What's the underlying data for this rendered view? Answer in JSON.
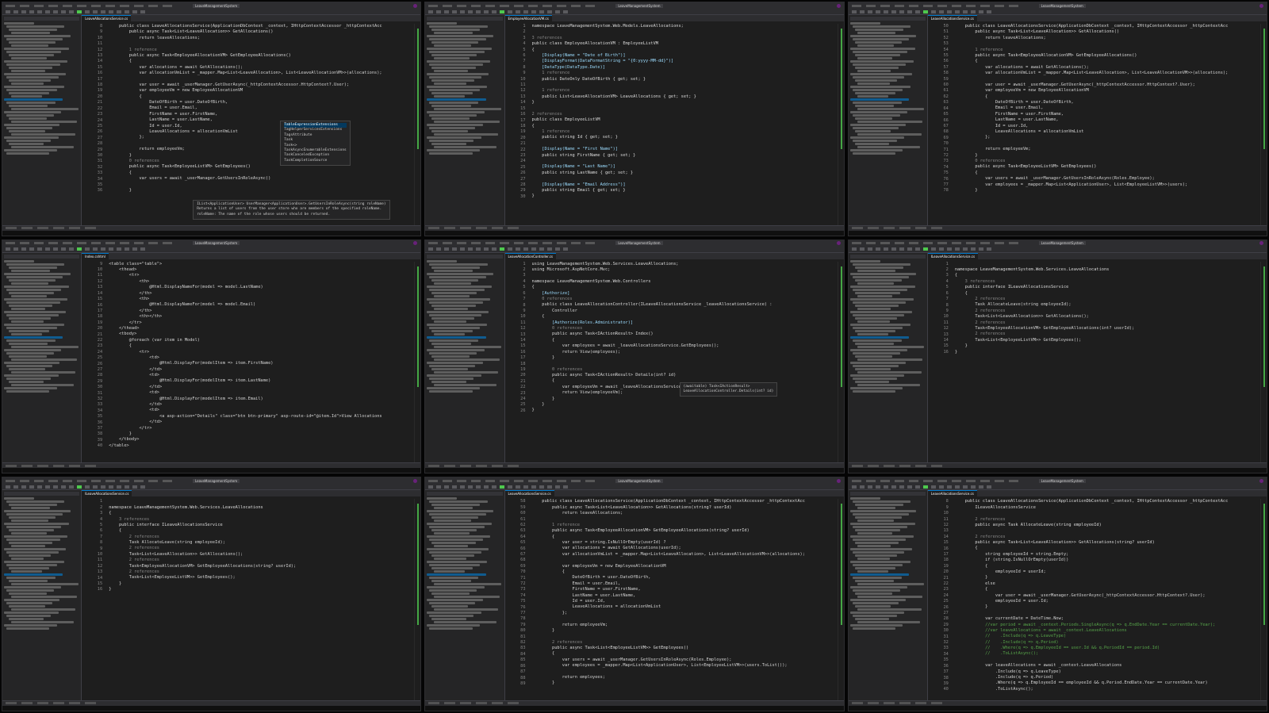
{
  "window": {
    "solution": "LeaveManagementSystem"
  },
  "panels": [
    {
      "tab": "LeaveAllocationsService.cs",
      "start": 8,
      "lines": [
        "    public class LeaveAllocationsService(ApplicationDbContext _context, IHttpContextAccessor _httpContextAcc",
        "        public async Task<List<LeaveAllocation>> GetAllocations()",
        "            return leaveAllocations;",
        "",
        "        1 reference",
        "        public async Task<EmployeeAllocationVM> GetEmployeeAllocations()",
        "        {",
        "            var allocations = await GetAllocations();",
        "            var allocationVmList = _mapper.Map<List<LeaveAllocation>, List<LeaveAllocationVM>>(allocations);",
        "",
        "            var user = await _userManager.GetUserAsync(_httpContextAccessor.HttpContext?.User);",
        "            var employeeVm = new EmployeeAllocationVM",
        "            {",
        "                DateOfBirth = user.DateOfBirth,",
        "                Email = user.Email,",
        "                FirstName = user.FirstName,",
        "                LastName = user.LastName,",
        "                Id = user.Id,",
        "                LeaveAllocations = allocationVmList",
        "            };",
        "",
        "            return employeeVm;",
        "        }",
        "        0 references",
        "        public async Task<EmployeeListVM> GetEmployees()",
        "        {",
        "            var users = await _userManager.GetUsersInRoleAsync()",
        "",
        "        }"
      ],
      "popup": {
        "items": [
          "TableExpressionExtensions",
          "TagHelperServicesExtensions",
          "TagsAttribute",
          "Task",
          "Task<>",
          "TaskAsyncEnumerableExtensions",
          "TaskCanceledException",
          "TaskCompletionSource"
        ],
        "tooltip": "IList<ApplicationUser> UserManager<ApplicationUser>.GetUsersInRoleAsync(string roleName)\nReturns a list of users from the user store who are members of the specified roleName.\nroleName: The name of the role whose users should be returned."
      }
    },
    {
      "tab": "EmployeeAllocationVM.cs",
      "start": 1,
      "lines": [
        "namespace LeaveManagementSystem.Web.Models.LeaveAllocations;",
        "",
        "3 references",
        "public class EmployeeAllocationVM : EmployeeListVM",
        "{",
        "    [Display(Name = \"Date of Birth\")]",
        "    [DisplayFormat(DataFormatString = \"{0:yyyy-MM-dd}\")]",
        "    [DataType(DataType.Date)]",
        "    1 reference",
        "    public DateOnly DateOfBirth { get; set; }",
        "",
        "    1 reference",
        "    public List<LeaveAllocationVM> LeaveAllocations { get; set; }",
        "}",
        "",
        "2 references",
        "public class EmployeeListVM",
        "{",
        "    1 reference",
        "    public string Id { get; set; }",
        "",
        "    [Display(Name = \"First Name\")]",
        "    public string FirstName { get; set; }",
        "",
        "    [Display(Name = \"Last Name\")]",
        "    public string LastName { get; set; }",
        "",
        "    [Display(Name = \"Email Address\")]",
        "    public string Email { get; set; }",
        "}"
      ]
    },
    {
      "tab": "LeaveAllocationsService.cs",
      "start": 50,
      "lines": [
        "    public class LeaveAllocationsService(ApplicationDbContext _context, IHttpContextAccessor _httpContextAcc",
        "        public async Task<List<LeaveAllocation>> GetAllocations()",
        "            return leaveAllocations;",
        "",
        "        1 reference",
        "        public async Task<EmployeeAllocationVM> GetEmployeeAllocations()",
        "        {",
        "            var allocations = await GetAllocations();",
        "            var allocationVmList = _mapper.Map<List<LeaveAllocation>, List<LeaveAllocationVM>>(allocations);",
        "",
        "            var user = await _userManager.GetUserAsync(_httpContextAccessor.HttpContext?.User);",
        "            var employeeVm = new EmployeeAllocationVM",
        "            {",
        "                DateOfBirth = user.DateOfBirth,",
        "                Email = user.Email,",
        "                FirstName = user.FirstName,",
        "                LastName = user.LastName,",
        "                Id = user.Id,",
        "                LeaveAllocations = allocationVmList",
        "            };",
        "",
        "            return employeeVm;",
        "        }",
        "        0 references",
        "        public async Task<EmployeeListVM> GetEmployees()",
        "        {",
        "            var users = await _userManager.GetUsersInRoleAsync(Roles.Employee);",
        "            var employees = _mapper.Map<List<ApplicationUser>, List<EmployeeListVM>>(users);",
        "        }"
      ]
    },
    {
      "tab": "Index.cshtml",
      "start": 9,
      "lines": [
        "<table class=\"table\">",
        "    <thead>",
        "        <tr>",
        "            <th>",
        "                @Html.DisplayNameFor(model => model.LastName)",
        "            </th>",
        "            <th>",
        "                @Html.DisplayNameFor(model => model.Email)",
        "            </th>",
        "            <th></th>",
        "        </tr>",
        "    </thead>",
        "    <tbody>",
        "        @foreach (var item in Model)",
        "        {",
        "            <tr>",
        "                <td>",
        "                    @Html.DisplayFor(modelItem => item.FirstName)",
        "                </td>",
        "                <td>",
        "                    @Html.DisplayFor(modelItem => item.LastName)",
        "                </td>",
        "                <td>",
        "                    @Html.DisplayFor(modelItem => item.Email)",
        "                </td>",
        "                <td>",
        "                    <a asp-action=\"Details\" class=\"btn btn-primary\" asp-route-id=\"@item.Id\">View Allocations",
        "                </td>",
        "            </tr>",
        "        }",
        "    </tbody>",
        "</table>"
      ]
    },
    {
      "tab": "LeaveAllocationController.cs",
      "start": 1,
      "lines": [
        "using LeaveManagementSystem.Web.Services.LeaveAllocations;",
        "using Microsoft.AspNetCore.Mvc;",
        "",
        "namespace LeaveManagementSystem.Web.Controllers",
        "{",
        "    [Authorize]",
        "    0 references",
        "    public class LeaveAllocationController(ILeaveAllocationsService _leaveAllocationsService) :",
        "        Controller",
        "    {",
        "        [Authorize(Roles.Administrator)]",
        "        0 references",
        "        public async Task<IActionResult> Index()",
        "        {",
        "            var employees = await _leaveAllocationsService.GetEmployees();",
        "            return View(employees);",
        "        }",
        "",
        "        0 references",
        "        public async Task<IActionResult> Details(int? id)",
        "        {",
        "            var employeeVm = await _leaveAllocationsService.GetEmployeeAllocations();",
        "            return View(employeeVm);",
        "        }",
        "    }",
        "}"
      ],
      "tooltip": "(awaitable) Task<IActionResult>\nLeaveAllocationController.Details(int? id)"
    },
    {
      "tab": "ILeaveAllocationsService.cs",
      "start": 1,
      "lines": [
        "",
        "namespace LeaveManagementSystem.Web.Services.LeaveAllocations",
        "{",
        "    3 references",
        "    public interface ILeaveAllocationsService",
        "    {",
        "        2 references",
        "        Task AllocateLeave(string employeeId);",
        "        2 references",
        "        Task<List<LeaveAllocation>> GetAllocations();",
        "        2 references",
        "        Task<EmployeeAllocationVM> GetEmployeeAllocations(int? userId);",
        "        2 references",
        "        Task<List<EmployeeListVM>> GetEmployees();",
        "    }",
        "}"
      ]
    },
    {
      "tab": "ILeaveAllocationsService.cs",
      "start": 1,
      "lines": [
        "",
        "namespace LeaveManagementSystem.Web.Services.LeaveAllocations",
        "{",
        "    3 references",
        "    public interface ILeaveAllocationsService",
        "    {",
        "        2 references",
        "        Task AllocateLeave(string employeeId);",
        "        2 references",
        "        Task<List<LeaveAllocation>> GetAllocations();",
        "        2 references",
        "        Task<EmployeeAllocationVM> GetEmployeeAllocations(string? userId);",
        "        2 references",
        "        Task<List<EmployeeListVM>> GetEmployees();",
        "    }",
        "}"
      ]
    },
    {
      "tab": "LeaveAllocationsService.cs",
      "start": 58,
      "lines": [
        "    public class LeaveAllocationsService(ApplicationDbContext _context, IHttpContextAccessor _httpContextAcc",
        "        public async Task<List<LeaveAllocation>> GetAllocations(string? userId)",
        "            return leaveAllocations;",
        "",
        "        1 reference",
        "        public async Task<EmployeeAllocationVM> GetEmployeeAllocations(string? userId)",
        "        {",
        "            var user = string.IsNullOrEmpty(userId) ? ",
        "            var allocations = await GetAllocations(userId);",
        "            var allocationVmList = _mapper.Map<List<LeaveAllocation>, List<LeaveAllocationVM>>(allocations);",
        "",
        "            var employeeVm = new EmployeeAllocationVM",
        "            {",
        "                DateOfBirth = user.DateOfBirth,",
        "                Email = user.Email,",
        "                FirstName = user.FirstName,",
        "                LastName = user.LastName,",
        "                Id = user.Id,",
        "                LeaveAllocations = allocationVmList",
        "            };",
        "",
        "            return employeeVm;",
        "        }",
        "",
        "        2 references",
        "        public async Task<List<EmployeeListVM>> GetEmployees()",
        "        {",
        "            var users = await _userManager.GetUsersInRoleAsync(Roles.Employee);",
        "            var employees = _mapper.Map<List<ApplicationUser>, List<EmployeeListVM>>(users.ToList());",
        "",
        "            return employees;",
        "        }"
      ]
    },
    {
      "tab": "LeaveAllocationsService.cs",
      "start": 8,
      "lines": [
        "    public class LeaveAllocationsService(ApplicationDbContext _context, IHttpContextAccessor _httpContextAcc",
        "        ILeaveAllocationsService",
        "",
        "        2 references",
        "        public async Task AllocateLeave(string employeeId)",
        "",
        "        2 references",
        "        public async Task<List<LeaveAllocation>> GetAllocations(string? userId)",
        "        {",
        "            string employeeId = string.Empty;",
        "            if (string.IsNullOrEmpty(userId))",
        "            {",
        "                employeeId = userId;",
        "            }",
        "            else",
        "            {",
        "                var user = await _userManager.GetUserAsync(_httpContextAccessor.HttpContext?.User);",
        "                employeeId = user.Id;",
        "            }",
        "",
        "            var currentDate = DateTime.Now;",
        "            //var period = await _context.Periods.SingleAsync(q => q.EndDate.Year == currentDate.Year);",
        "            //var leaveAllocations = await _context.LeaveAllocations",
        "            //    .Include(q => q.LeaveType)",
        "            //    .Include(q => q.Period)",
        "            //    .Where(q => q.EmployeeId == user.Id && q.PeriodId == period.Id)",
        "            //    .ToListAsync();",
        "",
        "            var leaveAllocations = await _context.LeaveAllocations",
        "                .Include(q => q.LeaveType)",
        "                .Include(q => q.Period)",
        "                .Where(q => q.EmployeeId == employeeId && q.Period.EndDate.Year == currentDate.Year)",
        "                .ToListAsync();"
      ]
    }
  ]
}
